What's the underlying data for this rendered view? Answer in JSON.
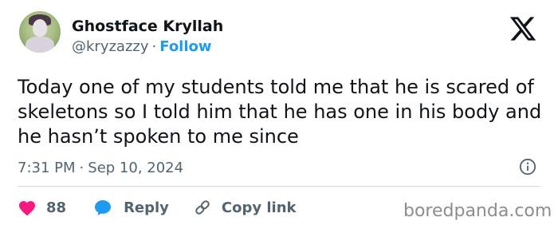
{
  "author": {
    "display_name": "Ghostface Kryllah",
    "handle": "@kryzazzy",
    "separator": "·",
    "follow_label": "Follow"
  },
  "tweet": {
    "text": "Today one of my students told me that he is scared of skeletons so I told him that he has one in his body and he hasn’t spoken to me since",
    "time": "7:31 PM",
    "separator": "·",
    "date": "Sep 10, 2024"
  },
  "actions": {
    "likes_count": "88",
    "reply_label": "Reply",
    "copy_link_label": "Copy link"
  },
  "watermark": "boredpanda.com",
  "colors": {
    "accent": "#1d9bf0",
    "like": "#f91880",
    "text": "#0f1419",
    "muted": "#536471",
    "divider": "#cfd9de"
  },
  "icons": [
    "x-logo-icon",
    "info-icon",
    "heart-icon",
    "reply-bubble-icon",
    "link-icon"
  ]
}
